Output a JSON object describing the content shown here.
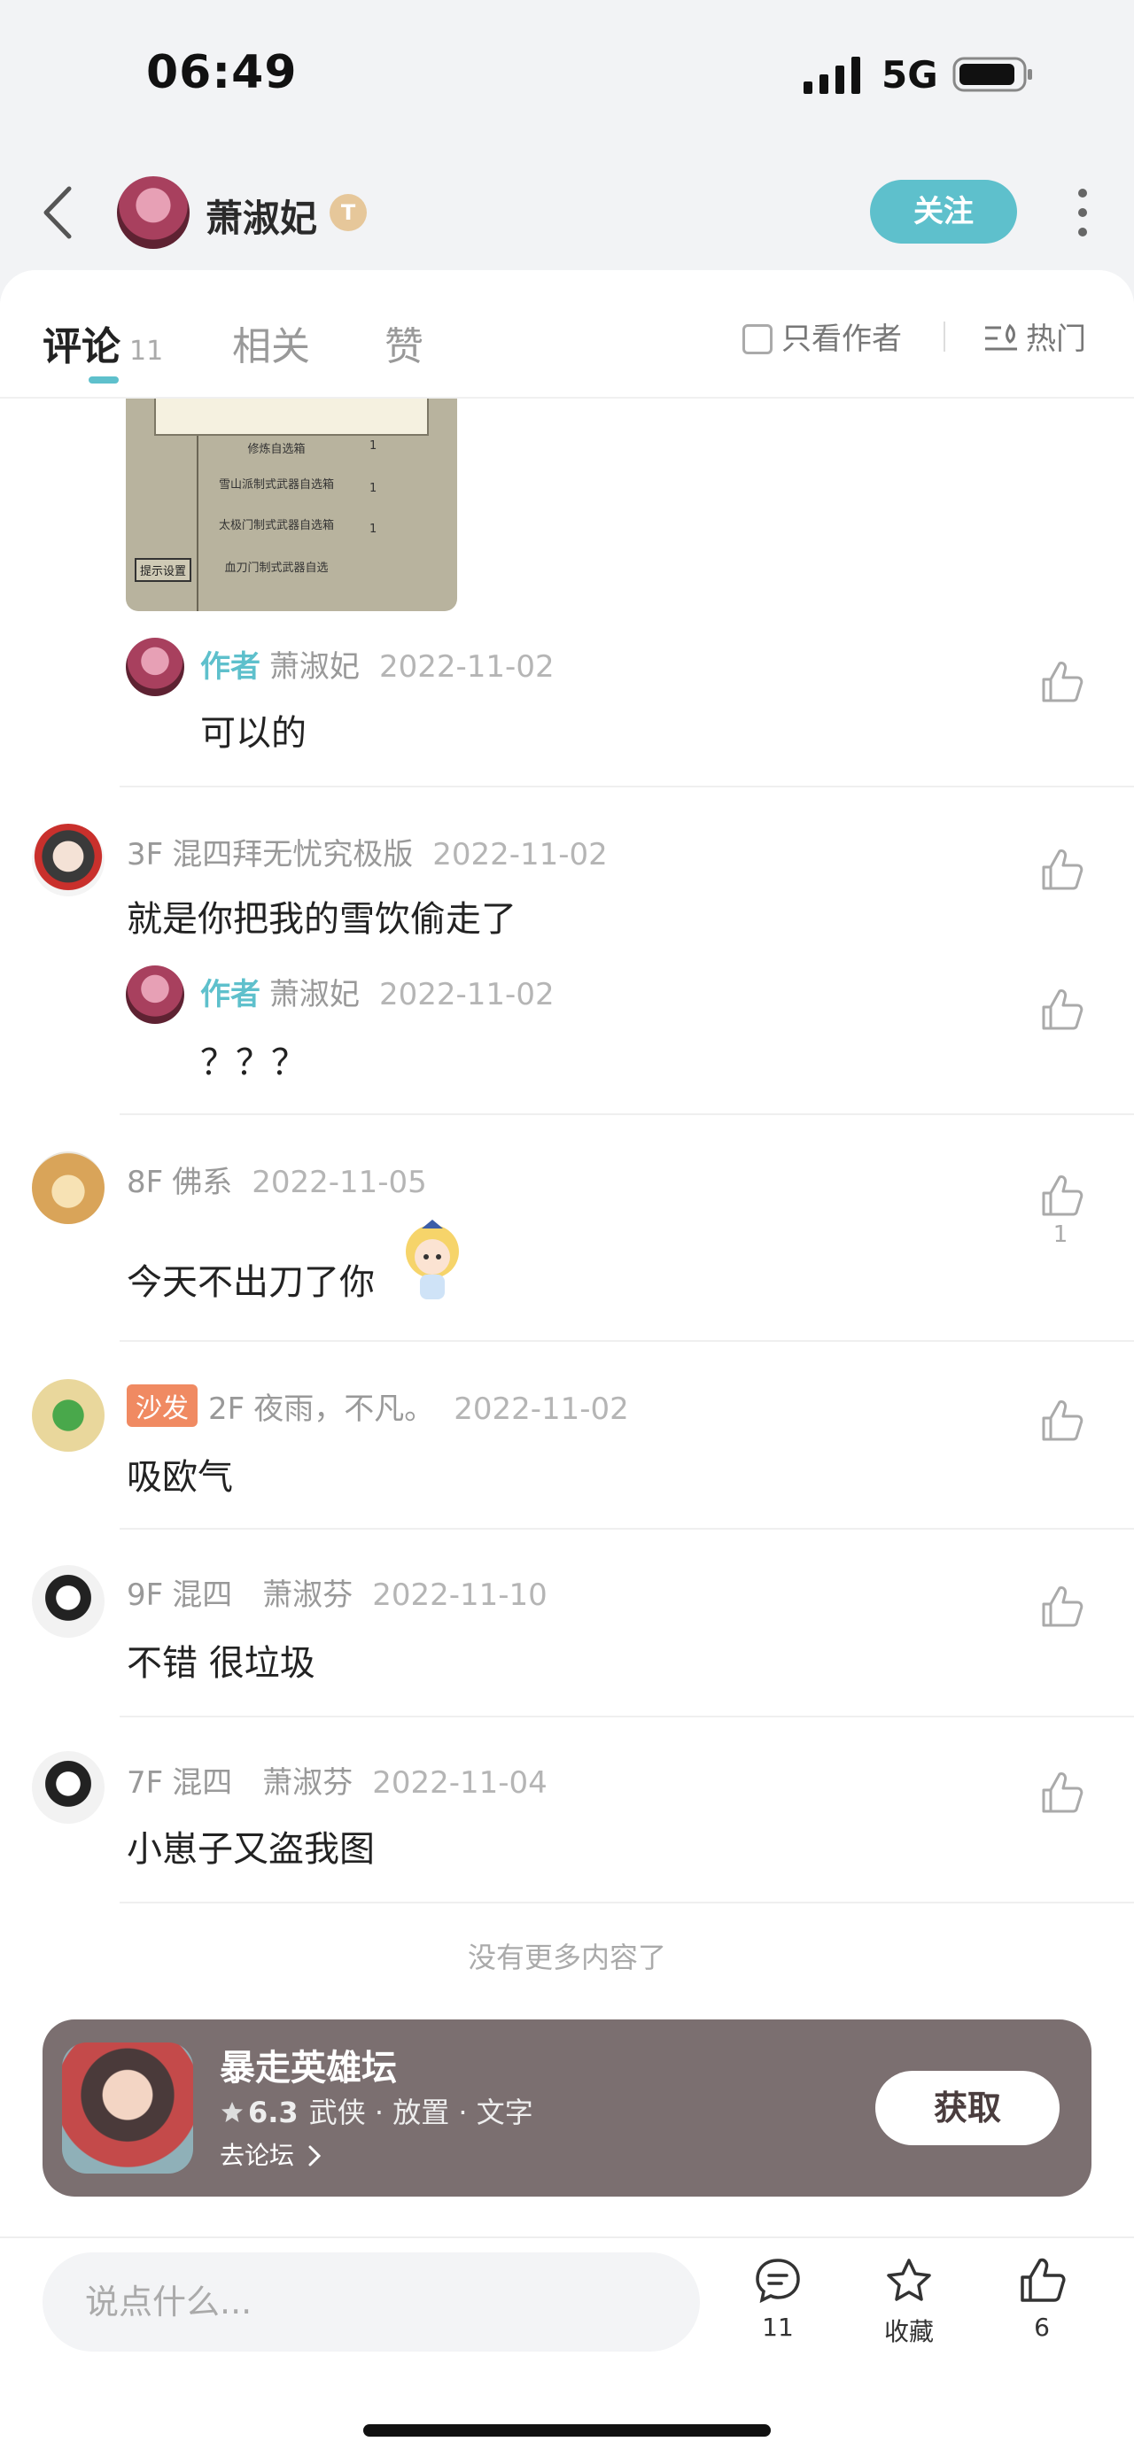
{
  "status": {
    "time": "06:49",
    "network": "5G"
  },
  "header": {
    "username": "萧淑妃",
    "badge": "T",
    "follow_label": "关注"
  },
  "tabs": {
    "comments_label": "评论",
    "comments_count": "11",
    "related_label": "相关",
    "likes_label": "赞",
    "author_only_label": "只看作者",
    "hot_label": "热门"
  },
  "attachment": {
    "lines": [
      "修炼自选箱",
      "雪山派制式武器自选箱",
      "太极门制式武器自选箱",
      "血刀门制式武器自选"
    ],
    "qty": [
      "1",
      "1",
      "1"
    ],
    "hint": "提示设置"
  },
  "comments": [
    {
      "is_reply": true,
      "author_tag": "作者",
      "name": "萧淑妃",
      "date": "2022-11-02",
      "text": "可以的"
    },
    {
      "floor": "3F",
      "name": "混四拜无忧究极版",
      "date": "2022-11-02",
      "text": "就是你把我的雪饮偷走了"
    },
    {
      "is_reply": true,
      "author_tag": "作者",
      "name": "萧淑妃",
      "date": "2022-11-02",
      "text": "？？？"
    },
    {
      "floor": "8F",
      "name": "佛系",
      "date": "2022-11-05",
      "text": "今天不出刀了你",
      "likes": "1"
    },
    {
      "sofa": "沙发",
      "floor": "2F",
      "name": "夜雨，不凡。",
      "date": "2022-11-02",
      "text": "吸欧气"
    },
    {
      "floor": "9F",
      "name": "混四　萧淑芬",
      "date": "2022-11-10",
      "text": "不错 很垃圾"
    },
    {
      "floor": "7F",
      "name": "混四　萧淑芬",
      "date": "2022-11-04",
      "text": "小崽子又盗我图"
    }
  ],
  "no_more": "没有更多内容了",
  "game_card": {
    "title": "暴走英雄坛",
    "score": "6.3",
    "tags": "武侠 · 放置 · 文字",
    "forum_link": "去论坛",
    "get_label": "获取"
  },
  "bottom_bar": {
    "placeholder": "说点什么...",
    "comment_count": "11",
    "favorite_label": "收藏",
    "like_count": "6"
  },
  "colors": {
    "accent": "#5ec0cc",
    "sofa": "#f08a62",
    "card": "#7b6f70"
  }
}
